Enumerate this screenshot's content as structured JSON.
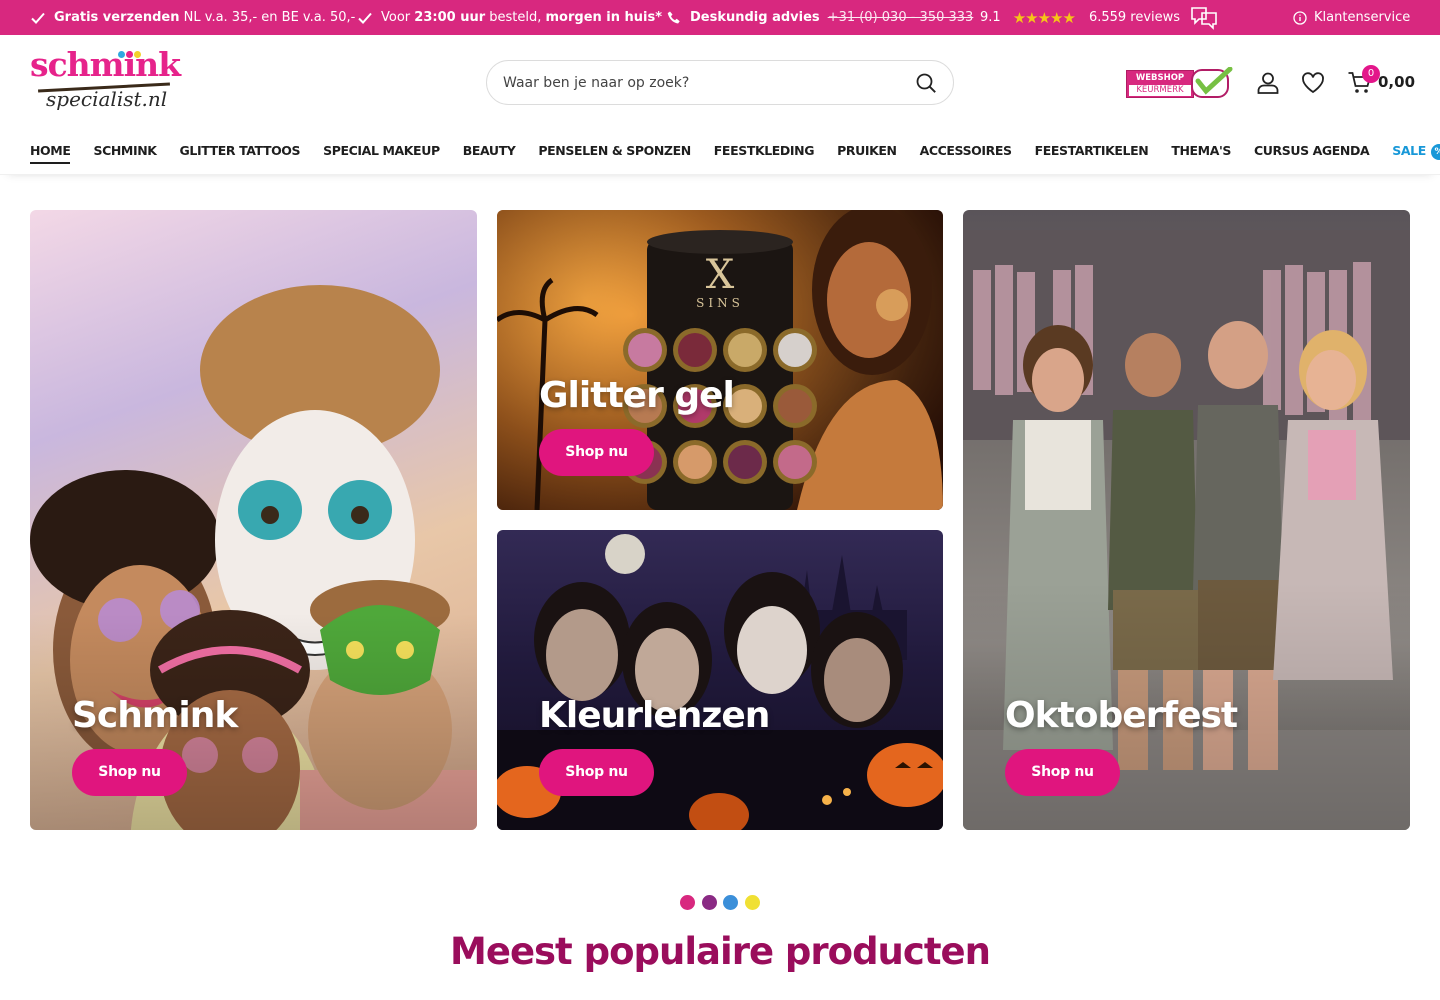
{
  "topbar": {
    "shipping_bold": "Gratis verzenden",
    "shipping_rest": "NL v.a. 35,- en BE v.a. 50,-",
    "order_pre": "Voor",
    "order_time": "23:00 uur",
    "order_mid": "besteld,",
    "order_bold": "morgen in huis*",
    "advice_label": "Deskundig advies",
    "advice_phone": "+31 (0) 030 - 350 333",
    "rating": "9.1",
    "reviews": "6.559 reviews",
    "customer_service": "Klantenservice"
  },
  "header": {
    "logo_line1": "schmink",
    "logo_line2": "specialist.nl",
    "search_placeholder": "Waar ben je naar op zoek?",
    "keurmerk_top": "WEBSHOP",
    "keurmerk_bottom": "KEURMERK",
    "cart_count": "0",
    "cart_total": "0,00"
  },
  "nav": {
    "items": [
      {
        "label": "HOME"
      },
      {
        "label": "SCHMINK"
      },
      {
        "label": "GLITTER TATTOOS"
      },
      {
        "label": "SPECIAL MAKEUP"
      },
      {
        "label": "BEAUTY"
      },
      {
        "label": "PENSELEN & SPONZEN"
      },
      {
        "label": "FEESTKLEDING"
      },
      {
        "label": "PRUIKEN"
      },
      {
        "label": "ACCESSOIRES"
      },
      {
        "label": "FEESTARTIKELEN"
      },
      {
        "label": "THEMA'S"
      },
      {
        "label": "CURSUS AGENDA"
      },
      {
        "label": "SALE"
      }
    ],
    "sale_badge": "%"
  },
  "tiles": {
    "schmink": {
      "title": "Schmink",
      "button": "Shop nu"
    },
    "glitter": {
      "title": "Glitter gel",
      "button": "Shop nu",
      "product_brand": "X",
      "product_sub": "SINS"
    },
    "lenzen": {
      "title": "Kleurlenzen",
      "button": "Shop nu"
    },
    "oktober": {
      "title": "Oktoberfest",
      "button": "Shop nu"
    }
  },
  "section": {
    "popular_title": "Meest populaire producten"
  },
  "colors": {
    "brand_pink": "#d8287f",
    "button_pink": "#e0157e",
    "sale_blue": "#1898d8",
    "heading_plum": "#9a0d5c",
    "dot_colors": [
      "#d8287f",
      "#8a2a84",
      "#3b8fd9",
      "#f0e033"
    ]
  }
}
